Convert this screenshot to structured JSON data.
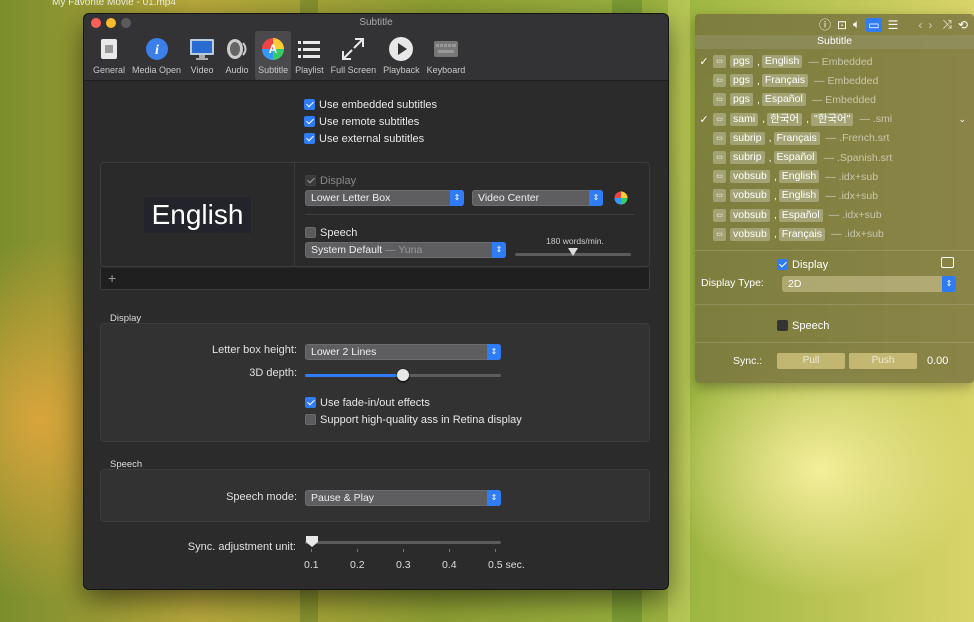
{
  "background": {
    "window_title": "My Favorite Movie - 01.mp4"
  },
  "prefs": {
    "title": "Subtitle",
    "toolbar": [
      {
        "label": "General",
        "icon": "general-icon"
      },
      {
        "label": "Media Open",
        "icon": "info-icon"
      },
      {
        "label": "Video",
        "icon": "monitor-icon"
      },
      {
        "label": "Audio",
        "icon": "speaker-icon"
      },
      {
        "label": "Subtitle",
        "icon": "color-wheel-icon"
      },
      {
        "label": "Playlist",
        "icon": "list-icon"
      },
      {
        "label": "Full Screen",
        "icon": "fullscreen-icon"
      },
      {
        "label": "Playback",
        "icon": "play-icon"
      },
      {
        "label": "Keyboard",
        "icon": "keyboard-icon"
      }
    ],
    "active_tab": "Subtitle",
    "checks": {
      "embedded": "Use embedded subtitles",
      "remote": "Use remote subtitles",
      "external": "Use external subtitles"
    },
    "preview": {
      "sample_text": "English",
      "display_label": "Display",
      "position_value": "Lower Letter Box",
      "align_value": "Video Center",
      "speech_label": "Speech",
      "voice_value": "System Default",
      "voice_name": "— Yuna",
      "rate_label": "180 words/min.",
      "add_symbol": "+"
    },
    "display_section": {
      "header": "Display",
      "letterbox_label": "Letter box height:",
      "letterbox_value": "Lower 2 Lines",
      "depth_label": "3D depth:",
      "depth_level": 0.5,
      "fade_label": "Use fade-in/out effects",
      "retina_label": "Support high-quality ass in Retina display"
    },
    "speech_section": {
      "header": "Speech",
      "mode_label": "Speech mode:",
      "mode_value": "Pause & Play"
    },
    "sync": {
      "label": "Sync. adjustment unit:",
      "ticks": [
        "0.1",
        "0.2",
        "0.3",
        "0.4",
        "0.5 sec."
      ],
      "selected": "0.1"
    }
  },
  "subpanel": {
    "title": "Subtitle",
    "tracks": [
      {
        "checked": true,
        "codec": "pgs",
        "lang": "English",
        "source": "— Embedded"
      },
      {
        "checked": false,
        "codec": "pgs",
        "lang": "Français",
        "source": "— Embedded"
      },
      {
        "checked": false,
        "codec": "pgs",
        "lang": "Español",
        "source": "— Embedded"
      },
      {
        "checked": true,
        "codec": "sami",
        "lang": "한국어",
        "lang2": "\"한국어\"",
        "source": "— .smi"
      },
      {
        "checked": false,
        "codec": "subrip",
        "lang": "Français",
        "source": "— .French.srt"
      },
      {
        "checked": false,
        "codec": "subrip",
        "lang": "Español",
        "source": "— .Spanish.srt"
      },
      {
        "checked": false,
        "codec": "vobsub",
        "lang": "English",
        "source": "— .idx+sub"
      },
      {
        "checked": false,
        "codec": "vobsub",
        "lang": "English",
        "source": "— .idx+sub"
      },
      {
        "checked": false,
        "codec": "vobsub",
        "lang": "Español",
        "source": "— .idx+sub"
      },
      {
        "checked": false,
        "codec": "vobsub",
        "lang": "Français",
        "source": "— .idx+sub"
      }
    ],
    "display_label": "Display",
    "display_type_label": "Display Type:",
    "display_type_value": "2D",
    "speech_label": "Speech",
    "sync_label": "Sync.:",
    "pull_label": "Pull",
    "push_label": "Push",
    "sync_value": "0.00"
  },
  "colors": {
    "accent": "#2f7cf6",
    "window_bg": "#2b2b2c"
  }
}
